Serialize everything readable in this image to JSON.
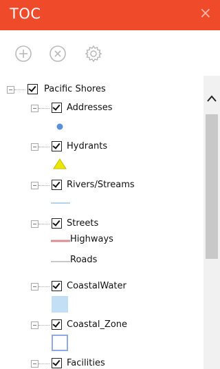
{
  "panel": {
    "title": "TOC",
    "close_glyph": "×"
  },
  "toolbar": {
    "icons": [
      "add-icon",
      "remove-icon",
      "settings-icon"
    ],
    "icon_color": "#b9b9b9"
  },
  "root": {
    "label": "Pacific Shores",
    "checked": true
  },
  "layers": [
    {
      "label": "Addresses",
      "checked": true,
      "symbol": "blue-dot"
    },
    {
      "label": "Hydrants",
      "checked": true,
      "symbol": "yellow-triangle"
    },
    {
      "label": "Rivers/Streams",
      "checked": true,
      "symbol": "light-blue-line"
    },
    {
      "label": "Streets",
      "checked": true,
      "legend": [
        "Highways",
        "Roads"
      ]
    },
    {
      "label": "CoastalWater",
      "checked": true,
      "symbol": "light-blue-square"
    },
    {
      "label": "Coastal_Zone",
      "checked": true,
      "symbol": "outlined-square"
    },
    {
      "label": "Facilities",
      "checked": true
    }
  ],
  "colors": {
    "titlebar": "#ef4b2b",
    "address_dot": "#5b8fd6",
    "hydrant": "#e8e800",
    "stream": "#b3d4ee",
    "highway": "#d98c92",
    "road": "#c8c8c8",
    "coastal_water": "#c2dff5",
    "coastal_zone_border": "#8fa8e6"
  }
}
